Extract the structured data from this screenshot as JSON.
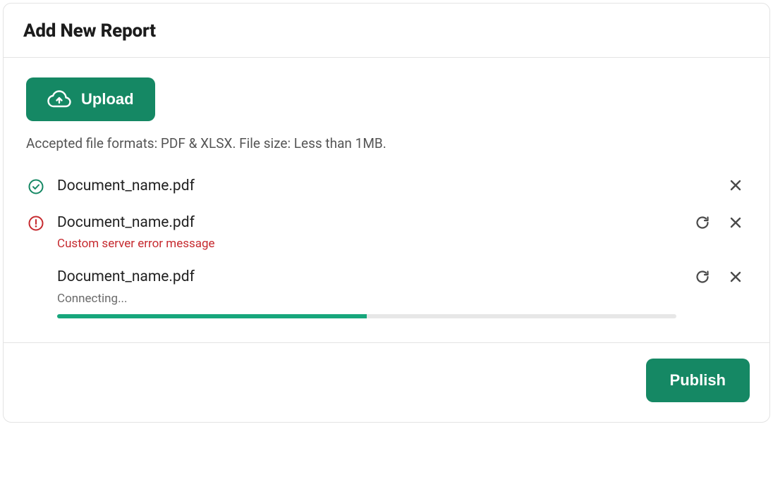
{
  "header": {
    "title": "Add New Report"
  },
  "upload": {
    "button_label": "Upload",
    "hint": "Accepted file formats: PDF & XLSX. File size: Less than 1MB."
  },
  "files": [
    {
      "name": "Document_name.pdf",
      "status": "success",
      "message": "",
      "can_retry": false,
      "can_remove": true
    },
    {
      "name": "Document_name.pdf",
      "status": "error",
      "message": "Custom server error message",
      "can_retry": true,
      "can_remove": true
    },
    {
      "name": "Document_name.pdf",
      "status": "uploading",
      "message": "Connecting...",
      "can_retry": true,
      "can_remove": true,
      "progress_percent": 50
    }
  ],
  "footer": {
    "publish_label": "Publish"
  },
  "colors": {
    "accent": "#158864",
    "error": "#c62a2f"
  }
}
